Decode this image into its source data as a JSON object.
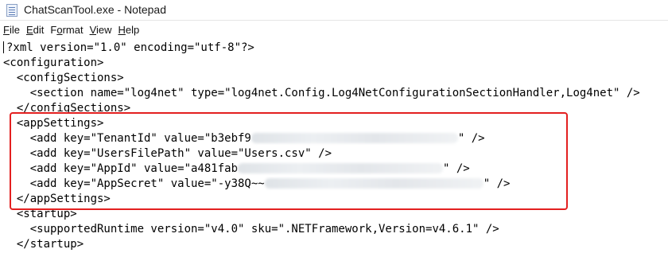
{
  "window": {
    "title": "ChatScanTool.exe - Notepad"
  },
  "menu": [
    {
      "pre": "",
      "u": "F",
      "post": "ile"
    },
    {
      "pre": "",
      "u": "E",
      "post": "dit"
    },
    {
      "pre": "F",
      "u": "o",
      "post": "rmat"
    },
    {
      "pre": "",
      "u": "V",
      "post": "iew"
    },
    {
      "pre": "",
      "u": "H",
      "post": "elp"
    }
  ],
  "lines": {
    "l0": "?xml version=\"1.0\" encoding=\"utf-8\"?>",
    "l1": "<configuration>",
    "l2": "  <configSections>",
    "l3": "    <section name=\"log4net\" type=\"log4net.Config.Log4NetConfigurationSectionHandler,Log4net\" />",
    "l4": "  </configSections>",
    "l5": "  <appSettings>",
    "l6a": "    <add key=\"TenantId\" value=\"b3ebf9",
    "l6b": "\" />",
    "l7a": "    <add key=\"UsersFilePath\" value=\"Users.csv",
    "l7b": "\" />",
    "l8a": "    <add key=\"AppId\" value=\"a481fab",
    "l8b": "\" />",
    "l9a": "    <add key=\"AppSecret\" value=\"-y38Q~~",
    "l9b": "\" />",
    "l10": "  </appSettings>",
    "l11": "  <startup>",
    "l12": "    <supportedRuntime version=\"v4.0\" sku=\".NETFramework,Version=v4.6.1\" />",
    "l13": "  </startup>"
  },
  "annotation": {
    "highlight_color": "#e32020"
  }
}
